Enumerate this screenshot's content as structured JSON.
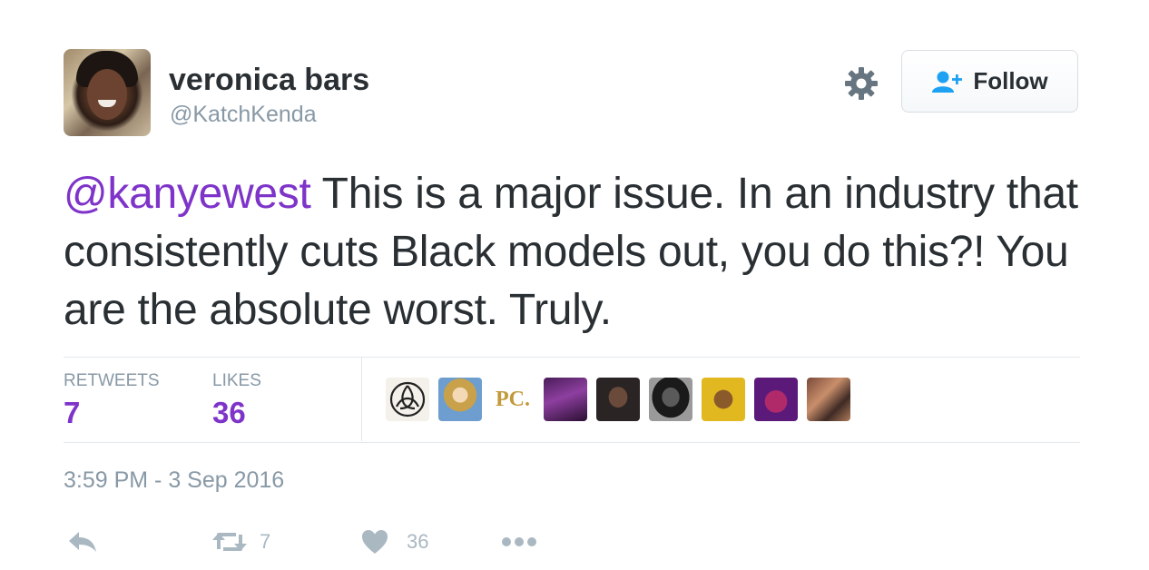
{
  "user": {
    "display_name": "veronica bars",
    "handle": "@KatchKenda"
  },
  "header": {
    "follow_label": "Follow"
  },
  "tweet": {
    "mention": "@kanyewest",
    "body": " This is a major issue. In an industry that consistently cuts Black models out, you do this?! You are the absolute worst. Truly."
  },
  "stats": {
    "retweets_label": "RETWEETS",
    "retweets_count": "7",
    "likes_label": "LIKES",
    "likes_count": "36"
  },
  "likers": [
    {
      "name": "liker-celtic-knot"
    },
    {
      "name": "liker-drag-queen"
    },
    {
      "name": "liker-pc-logo",
      "text": "PC."
    },
    {
      "name": "liker-purple-photo"
    },
    {
      "name": "liker-man-portrait"
    },
    {
      "name": "liker-woman-bw"
    },
    {
      "name": "liker-yellow-photo"
    },
    {
      "name": "liker-muppet"
    },
    {
      "name": "liker-woman-color"
    }
  ],
  "timestamp": "3:59 PM - 3 Sep 2016",
  "actions": {
    "retweet_count": "7",
    "like_count": "36"
  },
  "colors": {
    "accent_purple": "#7e34c9",
    "follow_blue": "#1da1f2",
    "muted_gray": "#8899a6",
    "icon_gray": "#aab8c2"
  },
  "icons": [
    "gear-icon",
    "follow-person-plus-icon",
    "reply-icon",
    "retweet-icon",
    "heart-icon",
    "more-dots-icon"
  ]
}
